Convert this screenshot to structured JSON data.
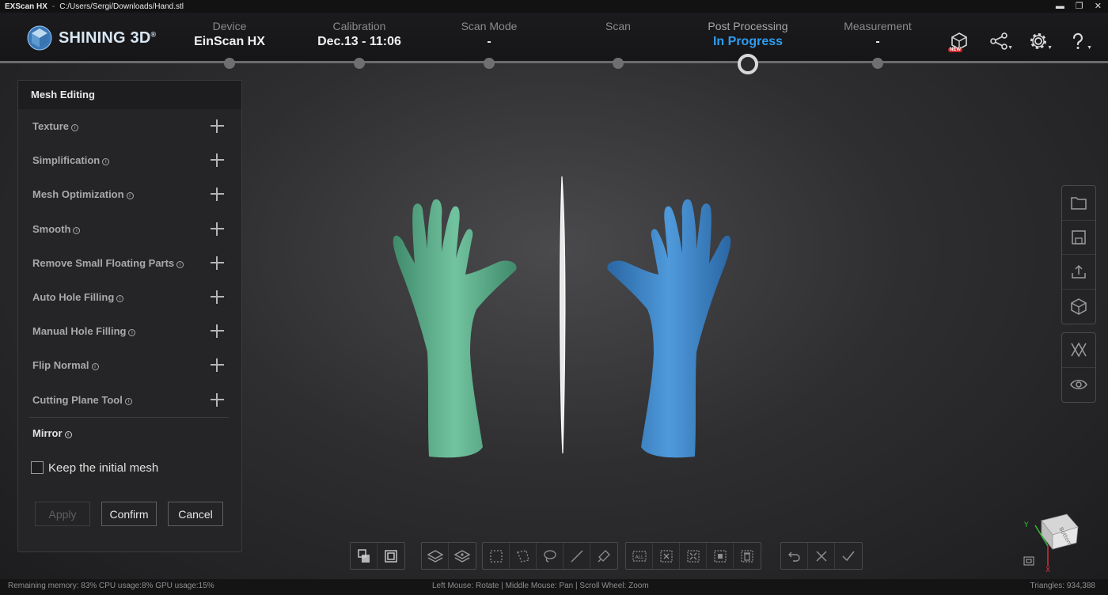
{
  "window": {
    "app_name": "EXScan HX",
    "separator": "-",
    "file_path": "C:/Users/Sergi/Downloads/Hand.stl"
  },
  "brand": {
    "name": "SHINING 3D",
    "mark": "®"
  },
  "steps": [
    {
      "label": "Device",
      "value": "EinScan HX"
    },
    {
      "label": "Calibration",
      "value": "Dec.13 - 11:06"
    },
    {
      "label": "Scan Mode",
      "value": "-"
    },
    {
      "label": "Scan",
      "value": ""
    },
    {
      "label": "Post Processing",
      "value": "In Progress"
    },
    {
      "label": "Measurement",
      "value": "-"
    }
  ],
  "header_icons": {
    "new_badge": "NEW"
  },
  "panel": {
    "title": "Mesh Editing",
    "tools": [
      "Texture",
      "Simplification",
      "Mesh Optimization",
      "Smooth",
      "Remove Small Floating Parts",
      "Auto Hole Filling",
      "Manual Hole Filling",
      "Flip Normal",
      "Cutting Plane Tool"
    ],
    "mirror_title": "Mirror",
    "keep_initial_mesh": "Keep the initial mesh",
    "apply": "Apply",
    "confirm": "Confirm",
    "cancel": "Cancel"
  },
  "colors": {
    "accent": "#2f9cf0",
    "mesh_left": "#5fae8c",
    "mesh_right": "#3f86c6"
  },
  "axis": {
    "y": "Y",
    "x": "X",
    "cube_face": "Bottom"
  },
  "status": {
    "left": "Remaining memory: 83% CPU usage:8%  GPU usage:15%",
    "mid": "Left Mouse: Rotate | Middle Mouse: Pan | Scroll Wheel: Zoom",
    "right": "Triangles: 934,388"
  }
}
